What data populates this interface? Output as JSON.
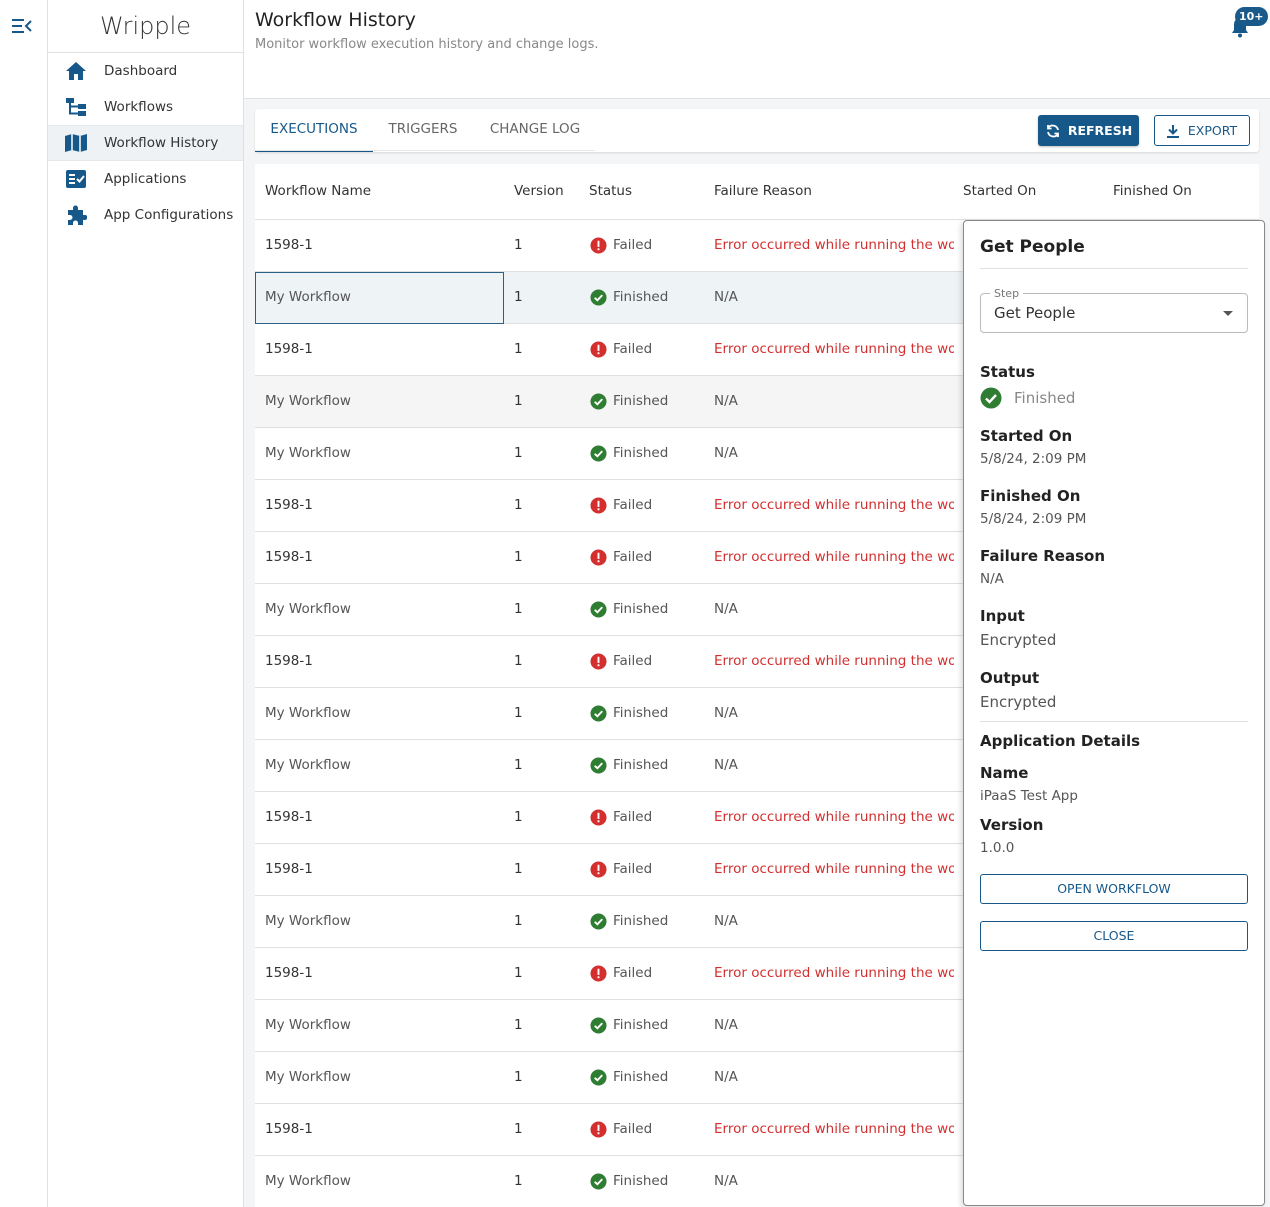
{
  "app": {
    "brand": "Wripple"
  },
  "sidebar": {
    "items": [
      {
        "label": "Dashboard",
        "icon": "home-icon"
      },
      {
        "label": "Workflows",
        "icon": "workflow-tree-icon"
      },
      {
        "label": "Workflow History",
        "icon": "map-book-icon",
        "active": true
      },
      {
        "label": "Applications",
        "icon": "checklist-icon"
      },
      {
        "label": "App Configurations",
        "icon": "puzzle-icon"
      }
    ]
  },
  "header": {
    "title": "Workflow History",
    "subtitle": "Monitor workflow execution history and change logs.",
    "notification_badge": "10+"
  },
  "tabs": [
    {
      "label": "EXECUTIONS",
      "active": true
    },
    {
      "label": "TRIGGERS",
      "active": false
    },
    {
      "label": "CHANGE LOG",
      "active": false
    }
  ],
  "toolbar": {
    "refresh_label": "REFRESH",
    "export_label": "EXPORT"
  },
  "table": {
    "columns": [
      "Workflow Name",
      "Version",
      "Status",
      "Failure Reason",
      "Started On",
      "Finished On"
    ],
    "rows": [
      {
        "name": "1598-1",
        "version": "1",
        "status": "Failed",
        "reason": "Error occurred while running the workflow"
      },
      {
        "name": "My Workflow",
        "version": "1",
        "status": "Finished",
        "reason": "N/A",
        "selected": true
      },
      {
        "name": "1598-1",
        "version": "1",
        "status": "Failed",
        "reason": "Error occurred while running the workflow"
      },
      {
        "name": "My Workflow",
        "version": "1",
        "status": "Finished",
        "reason": "N/A",
        "shaded": true
      },
      {
        "name": "My Workflow",
        "version": "1",
        "status": "Finished",
        "reason": "N/A"
      },
      {
        "name": "1598-1",
        "version": "1",
        "status": "Failed",
        "reason": "Error occurred while running the workflow"
      },
      {
        "name": "1598-1",
        "version": "1",
        "status": "Failed",
        "reason": "Error occurred while running the workflow"
      },
      {
        "name": "My Workflow",
        "version": "1",
        "status": "Finished",
        "reason": "N/A"
      },
      {
        "name": "1598-1",
        "version": "1",
        "status": "Failed",
        "reason": "Error occurred while running the workflow"
      },
      {
        "name": "My Workflow",
        "version": "1",
        "status": "Finished",
        "reason": "N/A"
      },
      {
        "name": "My Workflow",
        "version": "1",
        "status": "Finished",
        "reason": "N/A"
      },
      {
        "name": "1598-1",
        "version": "1",
        "status": "Failed",
        "reason": "Error occurred while running the workflow"
      },
      {
        "name": "1598-1",
        "version": "1",
        "status": "Failed",
        "reason": "Error occurred while running the workflow"
      },
      {
        "name": "My Workflow",
        "version": "1",
        "status": "Finished",
        "reason": "N/A"
      },
      {
        "name": "1598-1",
        "version": "1",
        "status": "Failed",
        "reason": "Error occurred while running the workflow"
      },
      {
        "name": "My Workflow",
        "version": "1",
        "status": "Finished",
        "reason": "N/A"
      },
      {
        "name": "My Workflow",
        "version": "1",
        "status": "Finished",
        "reason": "N/A"
      },
      {
        "name": "1598-1",
        "version": "1",
        "status": "Failed",
        "reason": "Error occurred while running the workflow"
      },
      {
        "name": "My Workflow",
        "version": "1",
        "status": "Finished",
        "reason": "N/A"
      }
    ]
  },
  "panel": {
    "title": "Get People",
    "step_label": "Step",
    "step_value": "Get People",
    "status_label": "Status",
    "status_value": "Finished",
    "started_label": "Started On",
    "started_value": "5/8/24, 2:09 PM",
    "finished_label": "Finished On",
    "finished_value": "5/8/24, 2:09 PM",
    "failure_label": "Failure Reason",
    "failure_value": "N/A",
    "input_label": "Input",
    "input_value": "Encrypted",
    "output_label": "Output",
    "output_value": "Encrypted",
    "app_details_label": "Application Details",
    "app_name_label": "Name",
    "app_name_value": "iPaaS Test App",
    "app_version_label": "Version",
    "app_version_value": "1.0.0",
    "open_button": "OPEN WORKFLOW",
    "close_button": "CLOSE"
  },
  "colors": {
    "primary": "#17588a",
    "success": "#2e7d32",
    "error": "#d32f2f"
  }
}
